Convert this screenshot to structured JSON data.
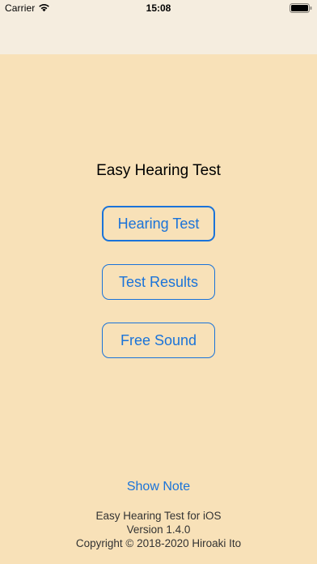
{
  "status_bar": {
    "carrier": "Carrier",
    "time": "15:08",
    "wifi_icon": "wifi-icon",
    "battery_icon": "battery-icon"
  },
  "main": {
    "title": "Easy Hearing Test",
    "buttons": [
      {
        "label": "Hearing Test"
      },
      {
        "label": "Test Results"
      },
      {
        "label": "Free Sound"
      }
    ],
    "show_note": "Show Note"
  },
  "footer": {
    "app_name": "Easy Hearing Test for iOS",
    "version": "Version 1.4.0",
    "copyright": "Copyright © 2018-2020 Hiroaki Ito"
  },
  "colors": {
    "background": "#f8e1b8",
    "nav_background": "#f5eddf",
    "accent": "#1a73d9"
  }
}
